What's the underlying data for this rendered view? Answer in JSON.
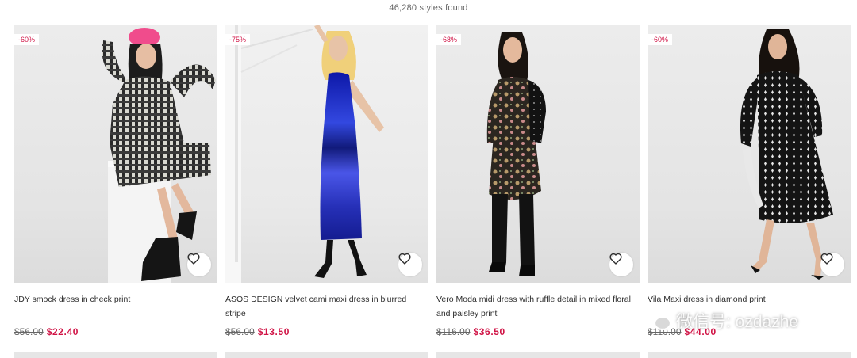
{
  "results": {
    "count_text": "46,280 styles found"
  },
  "products": [
    {
      "discount": "-60%",
      "name": "JDY smock dress in check print",
      "old_price": "$56.00",
      "new_price": "$22.40",
      "heart_icon": "heart-outline-icon"
    },
    {
      "discount": "-75%",
      "name": "ASOS DESIGN velvet cami maxi dress in blurred stripe",
      "old_price": "$56.00",
      "new_price": "$13.50",
      "heart_icon": "heart-outline-icon"
    },
    {
      "discount": "-68%",
      "name": "Vero Moda midi dress with ruffle detail in mixed floral and paisley print",
      "old_price": "$116.00",
      "new_price": "$36.50",
      "heart_icon": "heart-outline-icon"
    },
    {
      "discount": "-60%",
      "name": "Vila Maxi dress in diamond print",
      "old_price": "$110.00",
      "new_price": "$44.00",
      "heart_icon": "heart-outline-icon"
    }
  ],
  "watermark": {
    "text": "微信号: ozdazhe",
    "icon": "wechat-icon"
  },
  "colors": {
    "sale": "#d01345",
    "text": "#2d2d2d"
  }
}
